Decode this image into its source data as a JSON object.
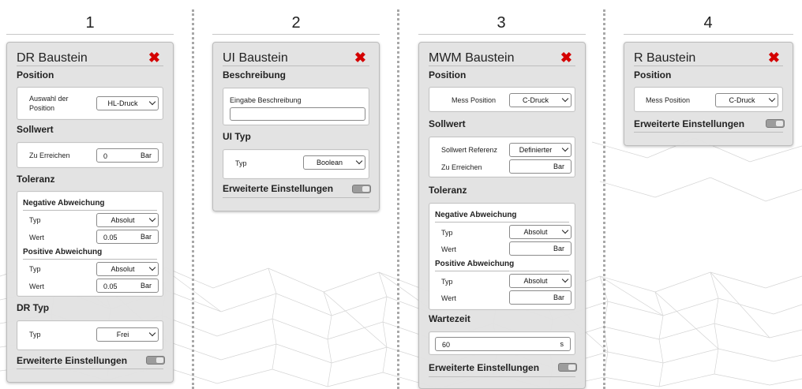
{
  "columns": [
    {
      "number": "1"
    },
    {
      "number": "2"
    },
    {
      "number": "3"
    },
    {
      "number": "4"
    }
  ],
  "close_glyph": "✖",
  "cards": {
    "dr": {
      "title": "DR Baustein",
      "position_label": "Position",
      "position_field_label": "Auswahl der Position",
      "position_value": "HL-Druck",
      "sollwert_label": "Sollwert",
      "zu_erreichen_label": "Zu Erreichen",
      "zu_erreichen_value": "0",
      "zu_erreichen_unit": "Bar",
      "toleranz_label": "Toleranz",
      "neg_label": "Negative Abweichung",
      "neg_typ_label": "Typ",
      "neg_typ_value": "Absolut",
      "neg_wert_label": "Wert",
      "neg_wert_value": "0.05",
      "neg_wert_unit": "Bar",
      "pos_label": "Positive Abweichung",
      "pos_typ_label": "Typ",
      "pos_typ_value": "Absolut",
      "pos_wert_label": "Wert",
      "pos_wert_value": "0.05",
      "pos_wert_unit": "Bar",
      "drtyp_label": "DR Typ",
      "drtyp_typ_label": "Typ",
      "drtyp_typ_value": "Frei",
      "advanced_label": "Erweiterte Einstellungen"
    },
    "ui": {
      "title": "UI Baustein",
      "beschreibung_label": "Beschreibung",
      "eingabe_label": "Eingabe Beschreibung",
      "eingabe_value": "",
      "uityp_label": "UI Typ",
      "typ_label": "Typ",
      "typ_value": "Boolean",
      "advanced_label": "Erweiterte Einstellungen"
    },
    "mwm": {
      "title": "MWM Baustein",
      "position_label": "Position",
      "mess_label": "Mess Position",
      "mess_value": "C-Druck",
      "sollwert_label": "Sollwert",
      "referenz_label": "Sollwert Referenz",
      "referenz_value": "Definierter",
      "zu_erreichen_label": "Zu Erreichen",
      "zu_erreichen_value": "",
      "zu_erreichen_unit": "Bar",
      "toleranz_label": "Toleranz",
      "neg_label": "Negative Abweichung",
      "neg_typ_label": "Typ",
      "neg_typ_value": "Absolut",
      "neg_wert_label": "Wert",
      "neg_wert_value": "",
      "neg_wert_unit": "Bar",
      "pos_label": "Positive Abweichung",
      "pos_typ_label": "Typ",
      "pos_typ_value": "Absolut",
      "pos_wert_label": "Wert",
      "pos_wert_value": "",
      "pos_wert_unit": "Bar",
      "wartezeit_label": "Wartezeit",
      "wartezeit_value": "60",
      "wartezeit_unit": "s",
      "advanced_label": "Erweiterte Einstellungen"
    },
    "r": {
      "title": "R Baustein",
      "position_label": "Position",
      "mess_label": "Mess Position",
      "mess_value": "C-Druck",
      "advanced_label": "Erweiterte Einstellungen"
    }
  },
  "colors": {
    "close": "#d40000",
    "card_bg": "#e2e2e2",
    "toggle": "#9c9c9c"
  }
}
